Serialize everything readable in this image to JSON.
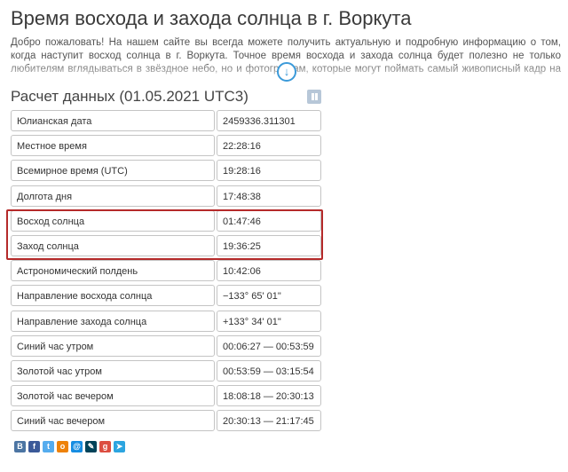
{
  "page": {
    "title": "Время восхода и захода солнца в г. Воркута",
    "intro": "Добро пожаловать! На нашем сайте вы всегда можете получить актуальную и подробную информацию о том, когда наступит восход солнца в г. Воркута. Точное время восхода и захода солнца будет полезно не только любителям вглядываться в звёздное небо, но и фотографам, которые могут поймать самый живописный кадр на стыке дня и"
  },
  "section": {
    "title": "Расчет данных (01.05.2021 UTC3)"
  },
  "rows": [
    {
      "label": "Юлианская дата",
      "value": "2459336.311301"
    },
    {
      "label": "Местное время",
      "value": "22:28:16"
    },
    {
      "label": "Всемирное время (UTC)",
      "value": "19:28:16"
    },
    {
      "label": "Долгота дня",
      "value": "17:48:38"
    },
    {
      "label": "Восход солнца",
      "value": "01:47:46"
    },
    {
      "label": "Заход солнца",
      "value": "19:36:25"
    },
    {
      "label": "Астрономический полдень",
      "value": "10:42:06"
    },
    {
      "label": "Направление восхода солнца",
      "value": "−133° 65' 01\""
    },
    {
      "label": "Направление захода солнца",
      "value": "+133° 34' 01\""
    },
    {
      "label": "Синий час утром",
      "value": "00:06:27 — 00:53:59"
    },
    {
      "label": "Золотой час утром",
      "value": "00:53:59 — 03:15:54"
    },
    {
      "label": "Золотой час вечером",
      "value": "18:08:18 — 20:30:13"
    },
    {
      "label": "Синий час вечером",
      "value": "20:30:13 — 21:17:45"
    }
  ],
  "share": [
    {
      "name": "vk-icon",
      "glyph": "В",
      "color": "#4c75a3"
    },
    {
      "name": "facebook-icon",
      "glyph": "f",
      "color": "#3b5998"
    },
    {
      "name": "twitter-icon",
      "glyph": "t",
      "color": "#55acee"
    },
    {
      "name": "odnoklassniki-icon",
      "glyph": "о",
      "color": "#ee8208"
    },
    {
      "name": "mailru-icon",
      "glyph": "@",
      "color": "#168de2"
    },
    {
      "name": "livejournal-icon",
      "glyph": "✎",
      "color": "#004359"
    },
    {
      "name": "googleplus-icon",
      "glyph": "g",
      "color": "#dc4e41"
    },
    {
      "name": "telegram-icon",
      "glyph": "➤",
      "color": "#2ca5e0"
    }
  ]
}
